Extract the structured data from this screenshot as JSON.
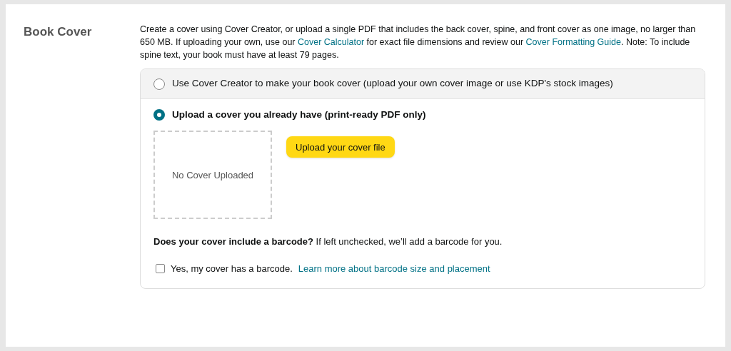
{
  "section_title": "Book Cover",
  "intro": [
    {
      "kind": "text",
      "text": "Create a cover using Cover Creator, or upload a single PDF that includes the back cover, spine, and front cover as one image, no larger than 650 MB. If uploading your own, use our "
    },
    {
      "kind": "link",
      "text": "Cover Calculator"
    },
    {
      "kind": "text",
      "text": " for exact file dimensions and review our "
    },
    {
      "kind": "link",
      "text": "Cover Formatting Guide"
    },
    {
      "kind": "text",
      "text": ". Note: To include spine text, your book must have at least 79 pages."
    }
  ],
  "options": [
    {
      "label": "Use Cover Creator to make your book cover (upload your own cover image or use KDP's stock images)",
      "selected": false
    },
    {
      "label": "Upload a cover you already have (print-ready PDF only)",
      "selected": true
    }
  ],
  "cover_preview": {
    "text": "No Cover Uploaded"
  },
  "upload_button": "Upload your cover file",
  "barcode_question": "**Does your cover include a barcode?** If left unchecked, we’ll add a barcode for you.",
  "barcode_checkbox": {
    "label": "Yes, my cover has a barcode.",
    "checked": false,
    "link": "Learn more about barcode size and placement"
  }
}
